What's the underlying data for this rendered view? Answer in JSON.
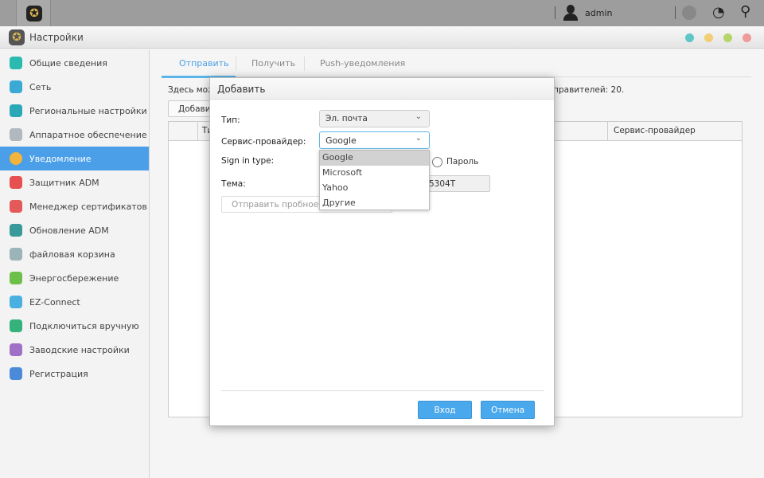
{
  "topbar": {
    "user": "admin",
    "icons": [
      "settings-app-icon",
      "user-icon",
      "notification-icon",
      "dashboard-icon",
      "search-icon"
    ]
  },
  "window": {
    "title": "Настройки",
    "window_buttons": [
      "#5fc6c8",
      "#f1cf72",
      "#b5d46a",
      "#f09a9a"
    ]
  },
  "sidebar": {
    "items": [
      {
        "label": "Общие сведения",
        "color": "#2bbab0"
      },
      {
        "label": "Сеть",
        "color": "#3aaad4"
      },
      {
        "label": "Региональные настройки",
        "color": "#2aa8b8"
      },
      {
        "label": "Аппаратное обеспечение",
        "color": "#b0b8c0"
      },
      {
        "label": "Уведомление",
        "color": "#f3b43d",
        "active": true
      },
      {
        "label": "Защитник ADM",
        "color": "#e65050"
      },
      {
        "label": "Менеджер сертификатов",
        "color": "#e45a5a"
      },
      {
        "label": "Обновление ADM",
        "color": "#3a9a9a"
      },
      {
        "label": "файловая корзина",
        "color": "#9ab4b8"
      },
      {
        "label": "Энергосбережение",
        "color": "#6cc04a"
      },
      {
        "label": "EZ-Connect",
        "color": "#4ab0e0"
      },
      {
        "label": "Подключиться вручную",
        "color": "#34b27a"
      },
      {
        "label": "Заводские настройки",
        "color": "#a070c8"
      },
      {
        "label": "Регистрация",
        "color": "#4a8ad8"
      }
    ]
  },
  "main": {
    "tabs": [
      "Отправить",
      "Получить",
      "Push-уведомления"
    ],
    "desc_left": "Здесь мож",
    "desc_right": "тправителей: 20.",
    "add_button": "Добавит",
    "columns": [
      "Ти",
      "Сервис-провайдер"
    ]
  },
  "dialog": {
    "title": "Добавить",
    "type_label": "Тип:",
    "type_value": "Эл. почта",
    "provider_label": "Сервис-провайдер:",
    "provider_value": "Google",
    "provider_options": [
      "Google",
      "Microsoft",
      "Yahoo",
      "Другие"
    ],
    "signin_label": "Sign in type:",
    "password_option": "Пароль",
    "subject_label": "Тема:",
    "subject_value": "5304T",
    "test_button": "Отправить пробное сообщение",
    "login_button": "Вход",
    "cancel_button": "Отмена"
  }
}
